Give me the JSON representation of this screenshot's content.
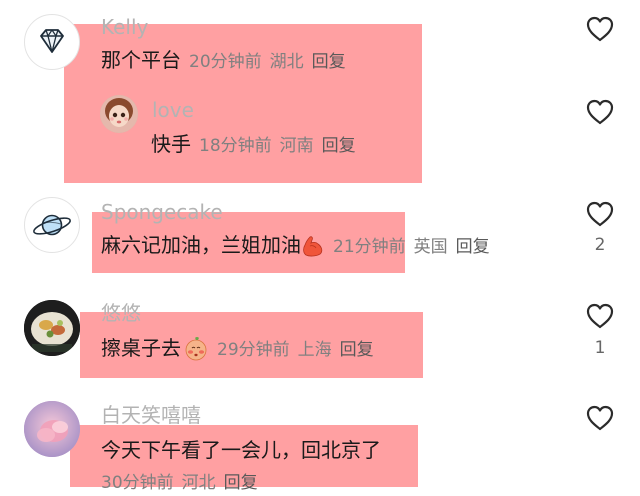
{
  "comments": [
    {
      "username": "Kelly",
      "content": "那个平台",
      "time": "20分钟前",
      "location": "湖北",
      "reply_label": "回复",
      "avatar_icon": "diamond-icon",
      "replies": [
        {
          "username": "love",
          "content": "快手",
          "time": "18分钟前",
          "location": "河南",
          "reply_label": "回复",
          "avatar_icon": "doll-avatar"
        }
      ]
    },
    {
      "username": "Spongecake",
      "content": "麻六记加油，兰姐加油",
      "emoji": "flexed-biceps-emoji",
      "time": "21分钟前",
      "location": "英国",
      "reply_label": "回复",
      "avatar_icon": "planet-icon",
      "likes": "2"
    },
    {
      "username": "悠悠",
      "content": "擦桌子去",
      "emoji": "blushing-face-emoji",
      "time": "29分钟前",
      "location": "上海",
      "reply_label": "回复",
      "avatar_icon": "food-photo-avatar",
      "likes": "1"
    },
    {
      "username": "白天笑嘻嘻",
      "content": "今天下午看了一会儿，回北京了",
      "time": "30分钟前",
      "location": "河北",
      "reply_label": "回复",
      "avatar_icon": "pink-cloud-avatar"
    }
  ],
  "colors": {
    "highlight": "#ff5256",
    "username": "#b3b3b3",
    "meta": "#808080"
  },
  "icons": {
    "like": "heart-outline-icon"
  }
}
